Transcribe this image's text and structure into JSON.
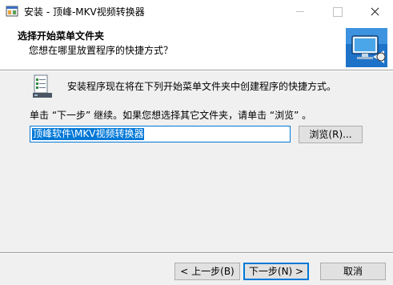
{
  "window": {
    "title": "安装 - 顶峰-MKV视频转换器",
    "app_icon": "installer-icon",
    "controls": [
      "minimize-icon",
      "maximize-icon",
      "close-icon"
    ]
  },
  "header": {
    "title": "选择开始菜单文件夹",
    "subtitle": "您想在哪里放置程序的快捷方式？",
    "icon": "computer-install-icon"
  },
  "content": {
    "icon": "start-menu-folder-icon",
    "info_text": "安装程序现在将在下列开始菜单文件夹中创建程序的快捷方式。",
    "instruction": "单击 “下一步” 继续。如果您想选择其它文件夹，请单击 “浏览” 。",
    "folder_value": "顶峰软件\\MKV视频转换器",
    "browse_label": "浏览(R)..."
  },
  "footer": {
    "back_label": "< 上一步(B)",
    "next_label": "下一步(N) >",
    "cancel_label": "取消"
  },
  "colors": {
    "accent": "#0078d7",
    "content_bg": "#f0f0f0",
    "button_bg": "#e1e1e1"
  }
}
